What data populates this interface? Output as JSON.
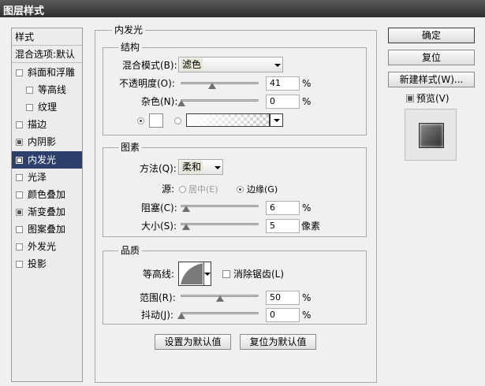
{
  "window": {
    "title": "图层样式"
  },
  "left_panel": {
    "header": "样式",
    "blend_options": "混合选项:默认",
    "items": [
      {
        "label": "斜面和浮雕",
        "checked": false
      },
      {
        "label": "等高线",
        "checked": false
      },
      {
        "label": "纹理",
        "checked": false
      },
      {
        "label": "描边",
        "checked": false
      },
      {
        "label": "内阴影",
        "checked": true
      },
      {
        "label": "内发光",
        "checked": true,
        "selected": true
      },
      {
        "label": "光泽",
        "checked": false
      },
      {
        "label": "颜色叠加",
        "checked": false
      },
      {
        "label": "渐变叠加",
        "checked": true
      },
      {
        "label": "图案叠加",
        "checked": false
      },
      {
        "label": "外发光",
        "checked": false
      },
      {
        "label": "投影",
        "checked": false
      }
    ]
  },
  "main": {
    "title": "内发光",
    "structure": {
      "title": "结构",
      "blend_mode_label": "混合模式(B):",
      "blend_mode_value": "滤色",
      "opacity_label": "不透明度(O):",
      "opacity_value": "41",
      "opacity_unit": "%",
      "noise_label": "杂色(N):",
      "noise_value": "0",
      "noise_unit": "%",
      "color_radio_selected": "solid"
    },
    "elements": {
      "title": "图素",
      "method_label": "方法(Q):",
      "method_value": "柔和",
      "source_label": "源:",
      "source_center": "居中(E)",
      "source_edge": "边缘(G)",
      "choke_label": "阻塞(C):",
      "choke_value": "6",
      "choke_unit": "%",
      "size_label": "大小(S):",
      "size_value": "5",
      "size_unit": "像素"
    },
    "quality": {
      "title": "品质",
      "contour_label": "等高线:",
      "antialias_label": "消除锯齿(L)",
      "range_label": "范围(R):",
      "range_value": "50",
      "range_unit": "%",
      "jitter_label": "抖动(J):",
      "jitter_value": "0",
      "jitter_unit": "%"
    },
    "set_default": "设置为默认值",
    "reset_default": "复位为默认值"
  },
  "right_panel": {
    "ok": "确定",
    "reset": "复位",
    "new_style": "新建样式(W)...",
    "preview_label": "预览(V)",
    "preview_checked": true
  },
  "colors": {
    "selected_bg": "#2d3f6b",
    "titlebar": "#3a3a3a",
    "glow_color": "#ffffff"
  }
}
